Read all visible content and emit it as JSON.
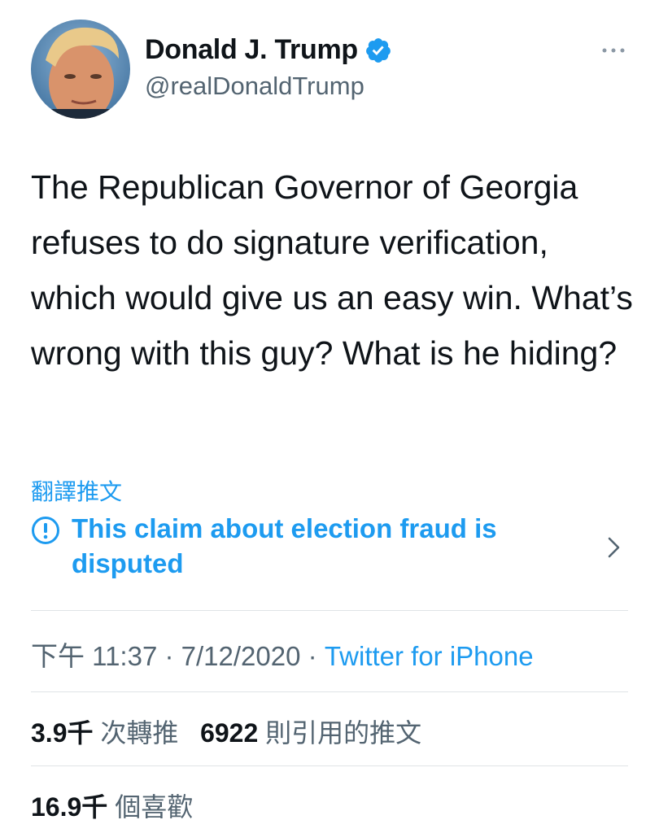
{
  "author": {
    "display_name": "Donald J. Trump",
    "handle": "@realDonaldTrump",
    "verified": true
  },
  "tweet": {
    "text": "The Republican Governor of Georgia refuses to do signature verification, which would give us an easy win. What’s wrong with this guy? What is he hiding?",
    "translate_label": "翻譯推文",
    "notice": "This claim about election fraud is disputed",
    "time": "下午 11:37",
    "date": "7/12/2020",
    "separator": "·",
    "source": "Twitter for iPhone"
  },
  "stats": {
    "retweets_count": "3.9千",
    "retweets_label": "次轉推",
    "quotes_count": "6922",
    "quotes_label": "則引用的推文",
    "likes_count": "16.9千",
    "likes_label": "個喜歡"
  },
  "colors": {
    "accent": "#1d9bf0",
    "text": "#0f1419",
    "secondary": "#536471",
    "divider": "#dfe3e6"
  },
  "icons": [
    "verified-badge-icon",
    "more-options-icon",
    "info-circle-icon",
    "chevron-right-icon"
  ]
}
